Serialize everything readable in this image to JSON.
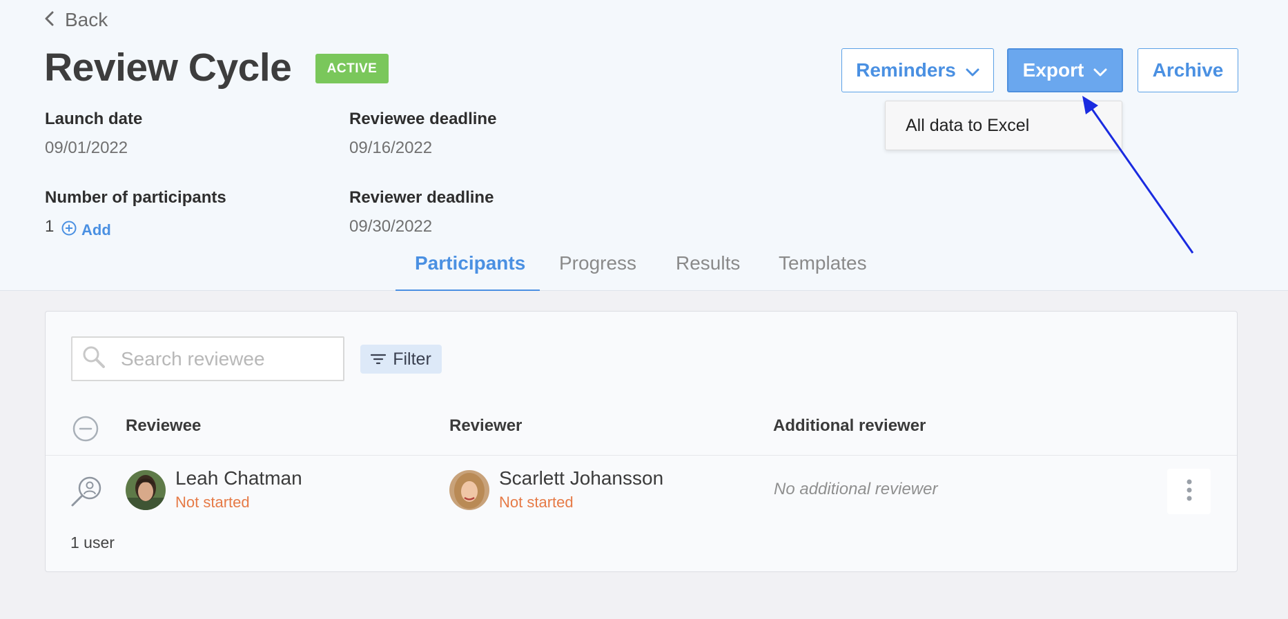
{
  "nav": {
    "back_label": "Back"
  },
  "header": {
    "title": "Review Cycle",
    "status_badge": "ACTIVE"
  },
  "details": {
    "launch_date_label": "Launch date",
    "launch_date": "09/01/2022",
    "reviewee_deadline_label": "Reviewee deadline",
    "reviewee_deadline": "09/16/2022",
    "participants_label": "Number of participants",
    "participants_count": "1",
    "add_label": "Add",
    "reviewer_deadline_label": "Reviewer deadline",
    "reviewer_deadline": "09/30/2022"
  },
  "actions": {
    "reminders_label": "Reminders",
    "export_label": "Export",
    "archive_label": "Archive",
    "export_menu": [
      "All data to Excel"
    ]
  },
  "tabs": [
    {
      "label": "Participants",
      "active": true
    },
    {
      "label": "Progress",
      "active": false
    },
    {
      "label": "Results",
      "active": false
    },
    {
      "label": "Templates",
      "active": false
    }
  ],
  "search": {
    "placeholder": "Search reviewee"
  },
  "filter": {
    "label": "Filter"
  },
  "table": {
    "headers": [
      "Reviewee",
      "Reviewer",
      "Additional reviewer"
    ],
    "rows": [
      {
        "reviewee": {
          "name": "Leah Chatman",
          "status": "Not started"
        },
        "reviewer": {
          "name": "Scarlett Johansson",
          "status": "Not started"
        },
        "additional_reviewer": "No additional reviewer"
      }
    ],
    "count_label": "1 user"
  },
  "colors": {
    "accent": "#4a90e2",
    "active_badge": "#7ac75b",
    "status_not_started": "#e67a46",
    "annotation_arrow": "#1a2be0"
  },
  "icons": [
    "chevron-left-icon",
    "chevron-down-icon",
    "plus-circle-icon",
    "search-icon",
    "filter-icon",
    "minus-circle-icon",
    "reviewee-search-icon",
    "more-vertical-icon"
  ]
}
